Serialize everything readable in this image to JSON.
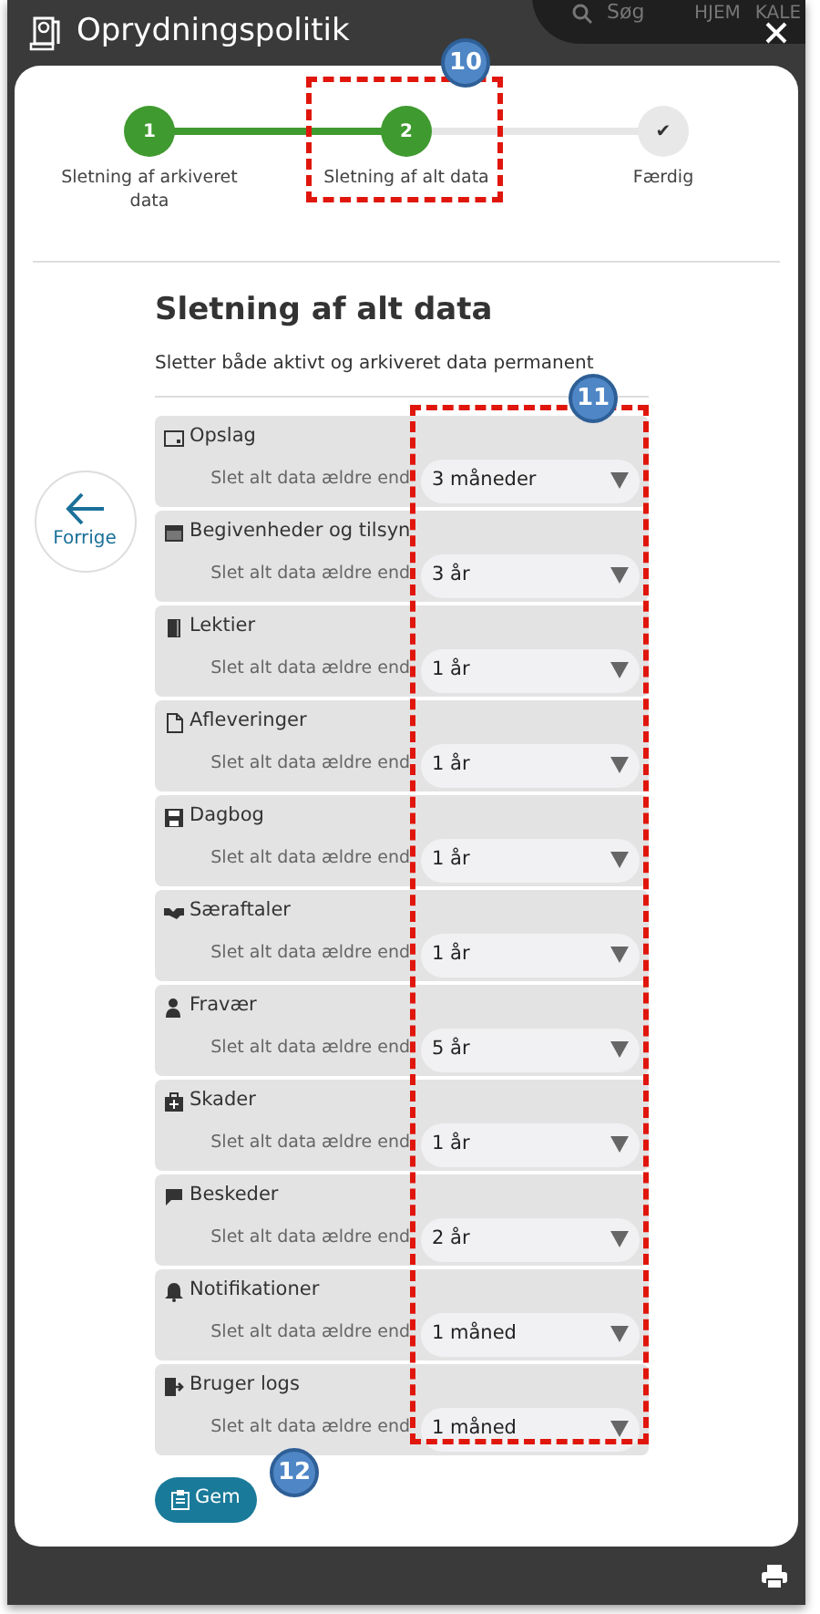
{
  "background": {
    "search_placeholder": "Søg",
    "nav": [
      "HJEM",
      "KALE"
    ]
  },
  "window": {
    "title": "Oprydningspolitik"
  },
  "steps": [
    {
      "number": "1",
      "label": "Sletning af arkiveret data",
      "done": true
    },
    {
      "number": "2",
      "label": "Sletning af alt data",
      "done": true
    },
    {
      "number": "✔",
      "label": "Færdig",
      "done": false
    }
  ],
  "heading": "Sletning af alt data",
  "description": "Sletter både aktivt og arkiveret data permanent",
  "back_button": "Forrige",
  "categories": [
    {
      "name": "Opslag",
      "label": "Slet alt data ældre end",
      "value": "3 måneder"
    },
    {
      "name": "Begivenheder og tilsyn",
      "label": "Slet alt data ældre end",
      "value": "3 år"
    },
    {
      "name": "Lektier",
      "label": "Slet alt data ældre end",
      "value": "1 år"
    },
    {
      "name": "Afleveringer",
      "label": "Slet alt data ældre end",
      "value": "1 år"
    },
    {
      "name": "Dagbog",
      "label": "Slet alt data ældre end",
      "value": "1 år"
    },
    {
      "name": "Særaftaler",
      "label": "Slet alt data ældre end",
      "value": "1 år"
    },
    {
      "name": "Fravær",
      "label": "Slet alt data ældre end",
      "value": "5 år"
    },
    {
      "name": "Skader",
      "label": "Slet alt data ældre end",
      "value": "1 år"
    },
    {
      "name": "Beskeder",
      "label": "Slet alt data ældre end",
      "value": "2 år"
    },
    {
      "name": "Notifikationer",
      "label": "Slet alt data ældre end",
      "value": "1 måned"
    },
    {
      "name": "Bruger logs",
      "label": "Slet alt data ældre end",
      "value": "1 måned"
    }
  ],
  "save_button": "Gem",
  "annotations": [
    {
      "number": "10",
      "kind": "step"
    },
    {
      "number": "11",
      "kind": "selects"
    },
    {
      "number": "12",
      "kind": "save"
    }
  ]
}
